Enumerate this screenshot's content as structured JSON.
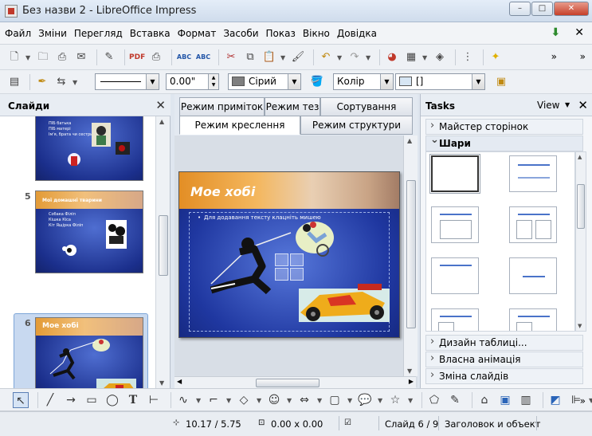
{
  "window": {
    "title": "Без назви 2 - LibreOffice Impress",
    "minimize": "–",
    "maximize": "□",
    "close": "✕"
  },
  "menu": {
    "items": [
      "Файл",
      "Зміни",
      "Перегляд",
      "Вставка",
      "Формат",
      "Засоби",
      "Показ",
      "Вікно",
      "Довідка"
    ]
  },
  "toolbar2": {
    "line_width": "0.00\"",
    "area_color": "Сірий",
    "fill_type": "Колір",
    "fill_value": "[]",
    "area_color_hex": "#7f7f7f",
    "fill_value_hex": "#d7e6f4"
  },
  "slides_pane": {
    "title": "Слайди",
    "slides": [
      {
        "number": "",
        "title": "",
        "bullets": [
          "ПІБ батька",
          "ПІБ матері",
          "Ім'я, брата чи сестри"
        ]
      },
      {
        "number": "5",
        "title": "Мої домашні тварини",
        "bullets": [
          "Собака Філіп",
          "Кішка Кіса",
          "Кіт Ящірка Філіп"
        ]
      },
      {
        "number": "6",
        "title": "Мое хобі",
        "bullets": []
      }
    ]
  },
  "view_tabs": {
    "row1": [
      "Режим приміток",
      "Режим тез",
      "Сортування слайду"
    ],
    "row2": [
      "Режим креслення",
      "Режим структури"
    ],
    "active": "Режим креслення"
  },
  "main_slide": {
    "title": "Мое хобі",
    "hint": "Для додавання тексту клацніть мишею"
  },
  "tasks_pane": {
    "title": "Tasks",
    "view": "View",
    "sections": {
      "master_pages": "Майстер сторінок",
      "layouts": "Шари",
      "table_design": "Дизайн таблиці...",
      "custom_animation": "Власна анімація",
      "slide_transition": "Зміна слайдів"
    }
  },
  "statusbar": {
    "position": "10.17 / 5.75",
    "size": "0.00 x 0.00",
    "slide": "Слайд 6 / 9",
    "layout": "Заголовок и объект"
  }
}
